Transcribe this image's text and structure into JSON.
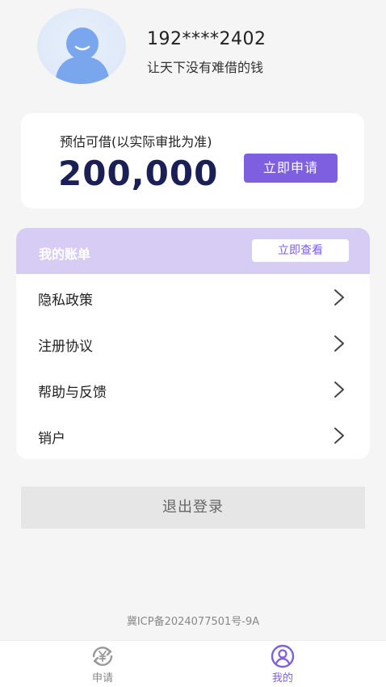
{
  "profile": {
    "phone": "192****2402",
    "slogan": "让天下没有难借的钱",
    "avatar_icon": "user-avatar-icon"
  },
  "loan": {
    "label": "预估可借(以实际审批为准)",
    "amount": "200,000",
    "apply_label": "立即申请"
  },
  "bill": {
    "title": "我的账单",
    "view_label": "立即查看"
  },
  "menu": [
    {
      "label": "隐私政策",
      "icon": "chevron-right-icon"
    },
    {
      "label": "注册协议",
      "icon": "chevron-right-icon"
    },
    {
      "label": "帮助与反馈",
      "icon": "chevron-right-icon"
    },
    {
      "label": "销户",
      "icon": "chevron-right-icon"
    }
  ],
  "logout_label": "退出登录",
  "icp": "冀ICP备2024077501号-9A",
  "tabs": [
    {
      "label": "申请",
      "icon": "yen-refresh-icon",
      "active": false
    },
    {
      "label": "我的",
      "icon": "user-circle-icon",
      "active": true
    }
  ],
  "colors": {
    "accent": "#7e5fe0",
    "bill_bar": "#d7cdf4",
    "amount_text": "#1a1f55",
    "background": "#f5f5f5"
  }
}
